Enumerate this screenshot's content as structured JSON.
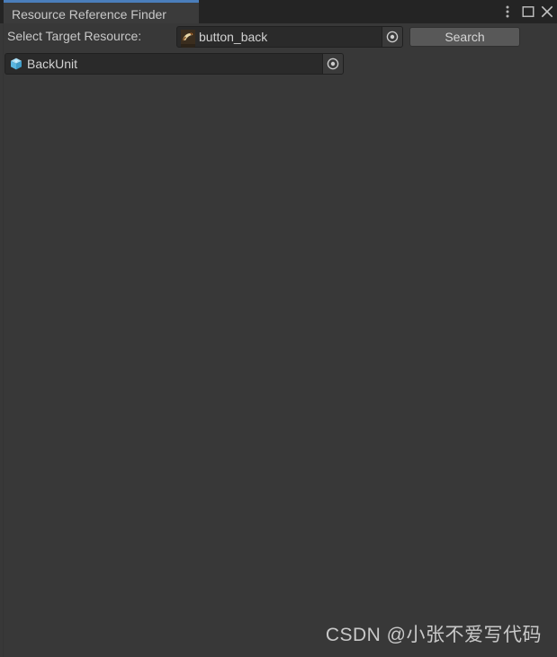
{
  "window": {
    "tab_label": "Resource Reference Finder",
    "accent_color": "#4a7ebb",
    "background_color": "#383838",
    "tabstrip_color": "#242424",
    "controls": {
      "menu_icon": "vertical-dots-icon",
      "maximize_icon": "maximize-square-icon",
      "close_icon": "close-x-icon"
    }
  },
  "toolbar": {
    "select_label": "Select Target Resource:",
    "target_field": {
      "value": "button_back",
      "icon": "sprite-texture-icon",
      "picker_icon": "object-picker-circle-icon"
    },
    "search_label": "Search"
  },
  "results": {
    "items": [
      {
        "value": "BackUnit",
        "icon": "prefab-cube-icon",
        "picker_icon": "object-picker-circle-icon"
      }
    ]
  },
  "watermark": {
    "text": "CSDN @小张不爱写代码"
  }
}
